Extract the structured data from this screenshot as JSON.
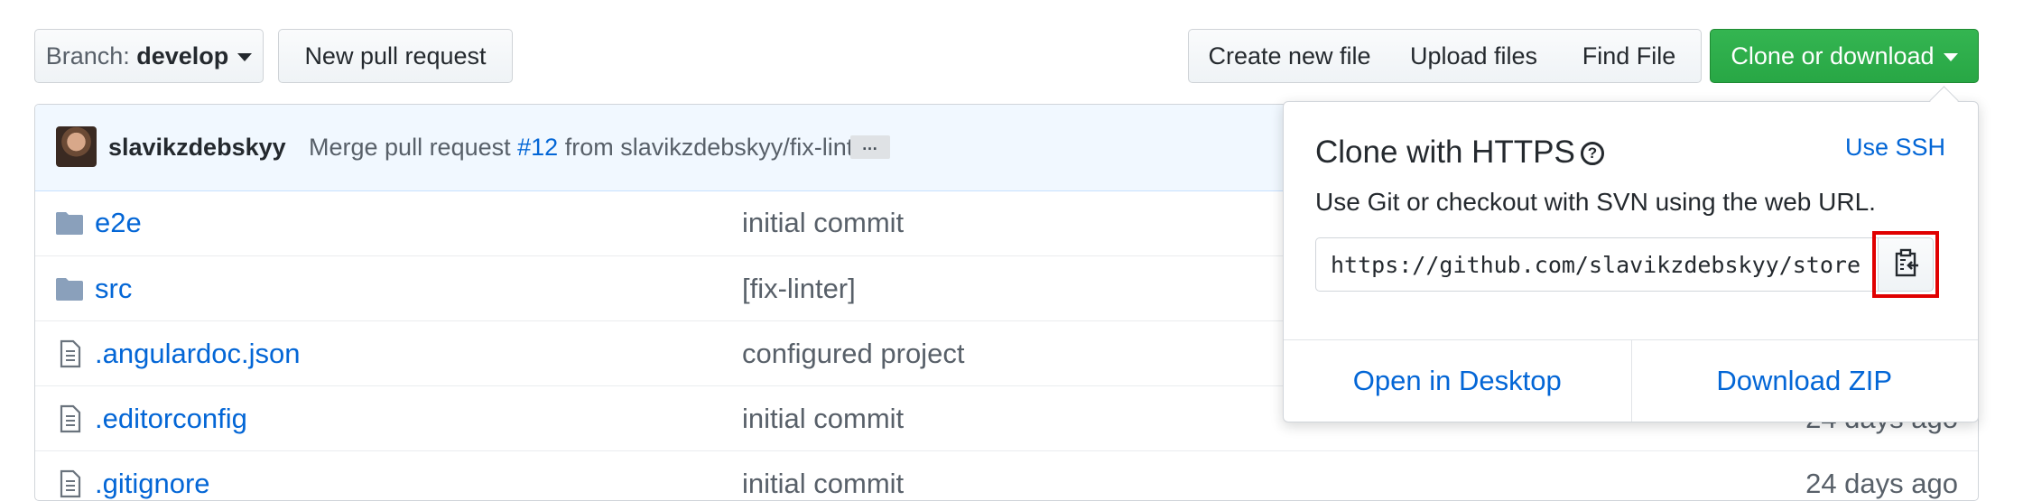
{
  "toolbar": {
    "branch_prefix": "Branch:",
    "branch_name": "develop",
    "new_pull_request": "New pull request",
    "create_new_file": "Create new file",
    "upload_files": "Upload files",
    "find_file": "Find File",
    "clone_or_download": "Clone or download"
  },
  "commit": {
    "author": "slavikzdebskyy",
    "message_prefix": "Merge pull request",
    "pr_number": "#12",
    "message_suffix": "from slavikzdebskyy/fix-linter",
    "ellipsis": "…"
  },
  "files": [
    {
      "name": "e2e",
      "type": "folder",
      "message": "initial commit",
      "age": ""
    },
    {
      "name": "src",
      "type": "folder",
      "message": "[fix-linter]",
      "age": ""
    },
    {
      "name": ".angulardoc.json",
      "type": "file",
      "message": "configured project",
      "age": ""
    },
    {
      "name": ".editorconfig",
      "type": "file",
      "message": "initial commit",
      "age": "24 days ago"
    },
    {
      "name": ".gitignore",
      "type": "file",
      "message": "initial commit",
      "age": "24 days ago"
    }
  ],
  "clone_popover": {
    "title": "Clone with HTTPS",
    "help_icon": "question-circle-icon",
    "use_ssh": "Use SSH",
    "description": "Use Git or checkout with SVN using the web URL.",
    "url": "https://github.com/slavikzdebskyy/store-",
    "copy_icon": "clippy-icon",
    "open_desktop": "Open in Desktop",
    "download_zip": "Download ZIP"
  },
  "colors": {
    "primary_green": "#28a745",
    "link_blue": "#0366d6",
    "highlight_red": "#e00000"
  }
}
